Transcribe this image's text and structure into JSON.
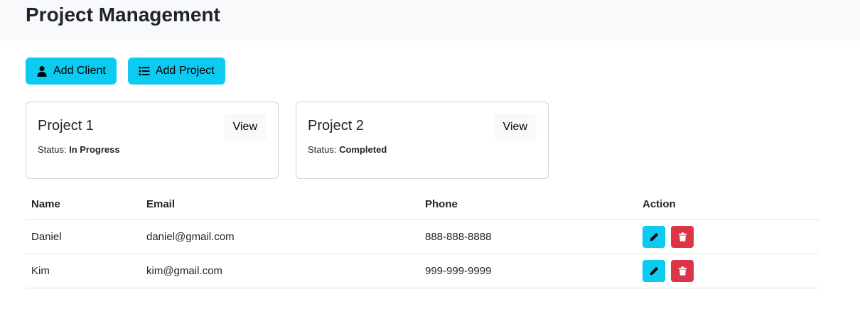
{
  "header": {
    "title": "Project Management"
  },
  "toolbar": {
    "add_client_label": "Add Client",
    "add_project_label": "Add Project"
  },
  "projects": [
    {
      "name": "Project 1",
      "status_label": "Status:",
      "status": "In Progress",
      "view_label": "View"
    },
    {
      "name": "Project 2",
      "status_label": "Status:",
      "status": "Completed",
      "view_label": "View"
    }
  ],
  "clients_table": {
    "columns": [
      "Name",
      "Email",
      "Phone",
      "Action"
    ],
    "rows": [
      {
        "name": "Daniel",
        "email": "daniel@gmail.com",
        "phone": "888-888-8888"
      },
      {
        "name": "Kim",
        "email": "kim@gmail.com",
        "phone": "999-999-9999"
      }
    ]
  },
  "colors": {
    "info": "#0dcaf0",
    "danger": "#dc3545",
    "header_bg": "#f8f9fa"
  },
  "icons": {
    "add_client": "user-icon",
    "add_project": "list-icon",
    "edit": "pencil-icon",
    "delete": "trash-icon"
  }
}
